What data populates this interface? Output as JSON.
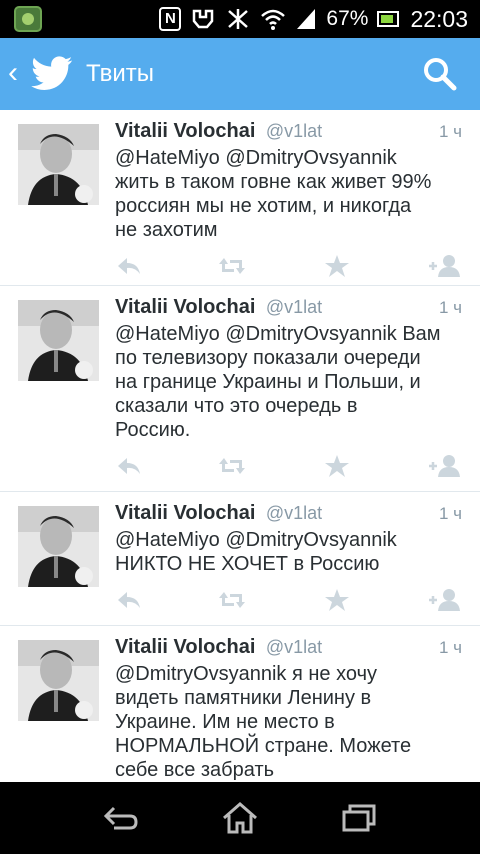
{
  "status_bar": {
    "battery": "67%",
    "time": "22:03",
    "icons": [
      "app-badge-icon",
      "nfc-icon",
      "usb-icon",
      "bluetooth-icon",
      "wifi-icon",
      "signal-icon",
      "battery-icon"
    ]
  },
  "action_bar": {
    "title": "Твиты",
    "icons": [
      "back-chevron-icon",
      "twitter-bird-icon",
      "search-icon"
    ],
    "accent": "#55acee"
  },
  "tweets": [
    {
      "name": "Vitalii Volochai",
      "handle": "@v1lat",
      "time": "1 ч",
      "lines": [
        "@HateMiyo @DmitryOvsyannik",
        "жить в таком говне как живет 99%",
        "россиян мы не хотим, и никогда",
        "не захотим"
      ]
    },
    {
      "name": "Vitalii Volochai",
      "handle": "@v1lat",
      "time": "1 ч",
      "lines": [
        "@HateMiyo @DmitryOvsyannik Вам",
        "по телевизору показали очереди",
        "на границе Украины и Польши, и",
        "сказали что это очередь в",
        "Россию."
      ]
    },
    {
      "name": "Vitalii Volochai",
      "handle": "@v1lat",
      "time": "1 ч",
      "lines": [
        "@HateMiyo @DmitryOvsyannik",
        "НИКТО НЕ ХОЧЕТ в Россию"
      ]
    },
    {
      "name": "Vitalii Volochai",
      "handle": "@v1lat",
      "time": "1 ч",
      "lines": [
        "@DmitryOvsyannik я не хочу",
        "видеть памятники Ленину в",
        "Украине. Им не место в",
        "НОРМАЛЬНОЙ стране. Можете",
        "себе все забрать"
      ]
    }
  ],
  "tweet_actions": [
    "reply-icon",
    "retweet-icon",
    "favorite-icon",
    "follow-icon"
  ],
  "nav_bar": {
    "icons": [
      "back-icon",
      "home-icon",
      "recent-apps-icon"
    ]
  }
}
